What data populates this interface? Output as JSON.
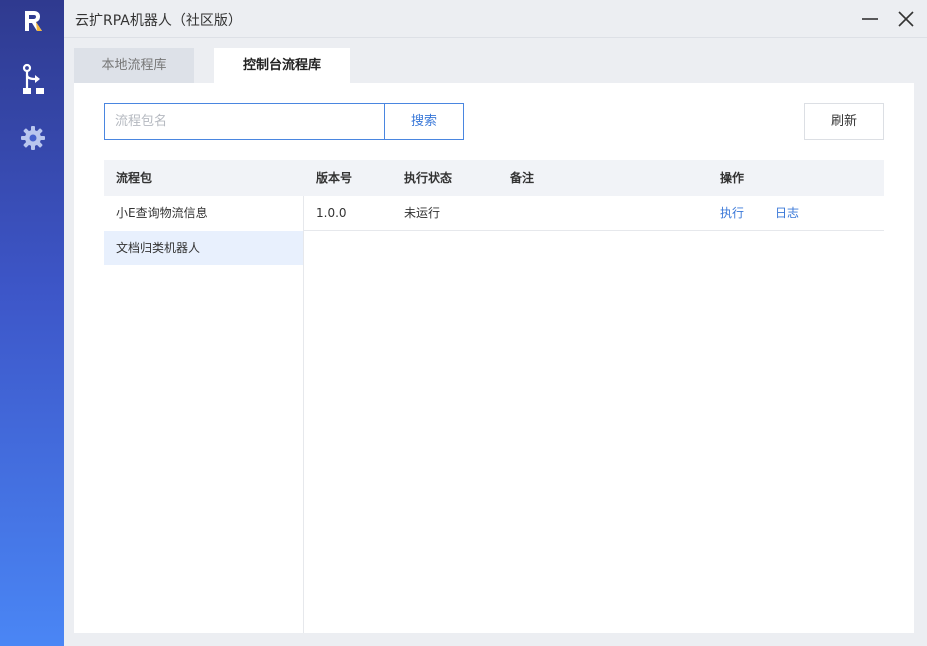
{
  "window": {
    "title": "云扩RPA机器人（社区版）"
  },
  "icons": {
    "logo": "brand-logo-icon",
    "flow": "flow-branch-icon",
    "settings": "gear-icon",
    "minimize": "minimize-icon",
    "close": "close-icon"
  },
  "colors": {
    "sidebar_top": "#2f3a8f",
    "sidebar_bottom": "#4a86f5",
    "accent": "#3a78d8",
    "selected_row": "#e8f0fd"
  },
  "tabs": [
    {
      "label": "本地流程库",
      "active": false
    },
    {
      "label": "控制台流程库",
      "active": true
    }
  ],
  "search": {
    "placeholder": "流程包名",
    "value": "",
    "button_label": "搜索"
  },
  "refresh_label": "刷新",
  "table": {
    "headers": {
      "package": "流程包",
      "version": "版本号",
      "status": "执行状态",
      "note": "备注",
      "actions": "操作"
    },
    "packages": [
      {
        "name": "小E查询物流信息",
        "selected": false
      },
      {
        "name": "文档归类机器人",
        "selected": true
      }
    ],
    "rows": [
      {
        "version": "1.0.0",
        "status": "未运行",
        "note": "",
        "action_run": "执行",
        "action_log": "日志"
      }
    ]
  }
}
